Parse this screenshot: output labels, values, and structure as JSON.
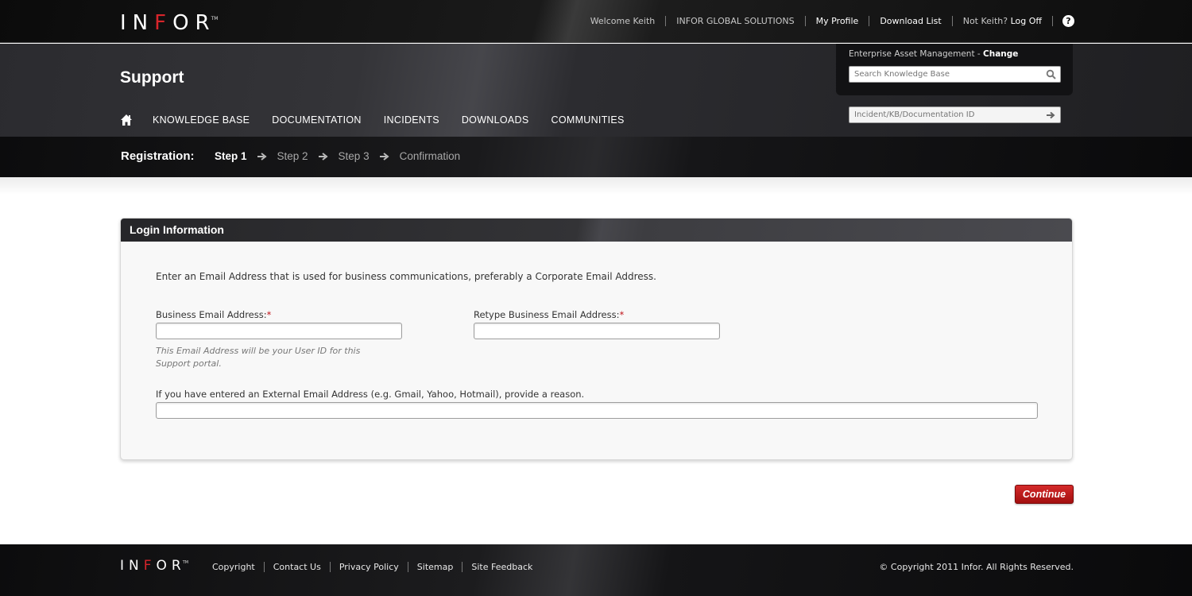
{
  "brand": {
    "logo_prefix": "IN",
    "logo_red": "F",
    "logo_suffix": "OR",
    "trademark": "TM",
    "accent_color": "#d8252b"
  },
  "usernav": {
    "welcome": "Welcome Keith",
    "company": "INFOR GLOBAL SOLUTIONS",
    "my_profile": "My Profile",
    "download_list": "Download List",
    "not_user": "Not Keith?",
    "log_off": "Log Off",
    "help": "?"
  },
  "header": {
    "title": "Support",
    "nav": [
      "KNOWLEDGE BASE",
      "DOCUMENTATION",
      "INCIDENTS",
      "DOWNLOADS",
      "COMMUNITIES"
    ]
  },
  "search": {
    "product": "Enterprise Asset Management",
    "separator": " - ",
    "change_label": "Change",
    "kb_placeholder": "Search Knowledge Base",
    "id_placeholder": "Incident/KB/Documentation ID"
  },
  "registration": {
    "label": "Registration:",
    "steps": [
      "Step 1",
      "Step 2",
      "Step 3",
      "Confirmation"
    ],
    "active_step": 0
  },
  "panel": {
    "title": "Login Information",
    "intro": "Enter an Email Address that is used for business communications, preferably a Corporate Email Address.",
    "email_label": "Business Email Address:",
    "retype_label": "Retype Business Email Address:",
    "required_mark": "*",
    "email_value": "",
    "retype_value": "",
    "hint": "This Email Address will be your User ID for this Support portal.",
    "reason_label": "If you have entered an External Email Address (e.g. Gmail, Yahoo, Hotmail), provide a reason.",
    "reason_value": ""
  },
  "actions": {
    "continue_label": "Continue"
  },
  "footer": {
    "links": [
      "Copyright",
      "Contact Us",
      "Privacy Policy",
      "Sitemap",
      "Site Feedback"
    ],
    "copyright": "© Copyright  2011 Infor. All Rights Reserved."
  }
}
